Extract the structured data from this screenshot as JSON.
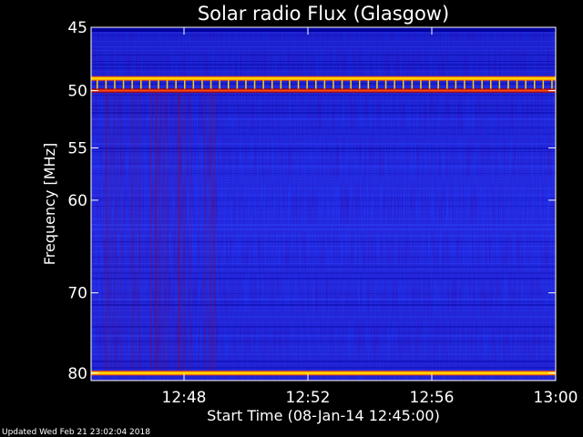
{
  "chart_data": {
    "type": "heatmap",
    "title": "Solar radio Flux (Glasgow)",
    "xlabel": "Start Time (08-Jan-14 12:45:00)",
    "ylabel": "Frequency [MHz]",
    "x_range": [
      "12:45",
      "13:00"
    ],
    "x_ticks": [
      "12:48",
      "12:52",
      "12:56",
      "13:00"
    ],
    "y_range": [
      45,
      81
    ],
    "y_ticks": [
      45,
      50,
      55,
      60,
      70,
      80
    ],
    "y_scale": "log",
    "colormap": [
      "#0000a0",
      "#1a2cff",
      "#8a0a3a",
      "#ff4a00",
      "#ffd200"
    ],
    "emission_lines_mhz": [
      49,
      50,
      80
    ],
    "footer": "Updated Wed Feb 21 23:02:04 2018"
  }
}
